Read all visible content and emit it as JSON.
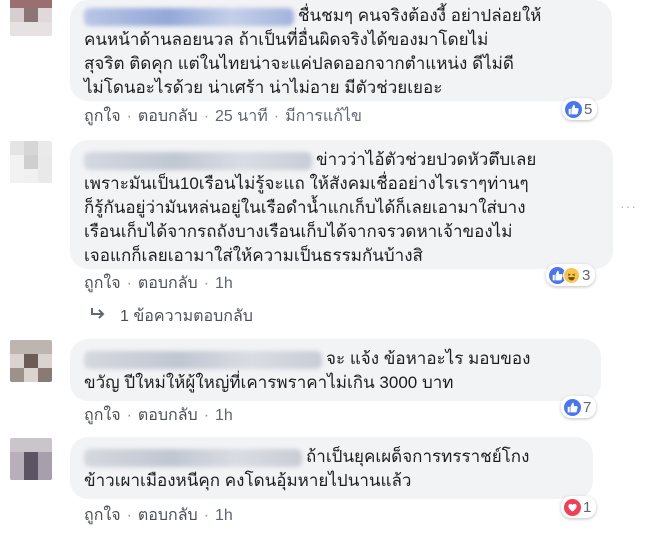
{
  "comments": [
    {
      "text": "ชื่นชมๆ คนจริงต้องงี้ อย่าปล่อยให้\nคนหน้าด้านลอยนวล ถ้าเป็นที่อื่นผิดจริงได้ของมาโดยไม่\nสุจริต ติดคุก แต่ในไทยน่าจะแค่ปลดออกจากตำแหน่ง ดีไม่ดี\nไม่โดนอะไรด้วย น่าเศร้า น่าไม่อาย มีตัวช่วยเยอะ",
      "actions": {
        "like": "ถูกใจ",
        "reply": "ตอบกลับ",
        "time": "25 นาที",
        "edited": "มีการแก้ไข"
      },
      "reaction_count": "5"
    },
    {
      "text": "ข่าวว่าไอ้ตัวช่วยปวดหัวตึบเลย\nเพราะมันเป็น10เรือนไม่รู้จะแถ ให้สังคมเชื่ออย่างไรเราๆท่านๆ\nก็รู้กันอยู่ว่ามันหล่นอยู่ในเรือดำน้ำแกเก็บได้ก็เลยเอามาใส่บาง\nเรือนเก็บได้จากรถถังบางเรือนเก็บได้จากจรวดหาเจ้าของไม่\nเจอแกก็เลยเอามาใส่ให้ความเป็นธรรมกันบ้างสิ",
      "actions": {
        "like": "ถูกใจ",
        "reply": "ตอบกลับ",
        "time": "1h"
      },
      "reaction_count": "3",
      "more": "···",
      "replies_label": "1 ข้อความตอบกลับ"
    },
    {
      "text": "จะ แจ้ง ข้อหาอะไร มอบของ\nขวัญ ปีใหม่ให้ผู้ใหญ่ที่เคารพราคาไม่เกิน 3000 บาท",
      "actions": {
        "like": "ถูกใจ",
        "reply": "ตอบกลับ",
        "time": "1h"
      },
      "reaction_count": "7"
    },
    {
      "text": "ถ้าเป็นยุคเผด็จการทรราชย์โกง\nข้าวเผาเมืองหนีคุก คงโดนอุ้มหายไปนานแล้ว",
      "actions": {
        "like": "ถูกใจ",
        "reply": "ตอบกลับ",
        "time": "1h"
      },
      "reaction_count": "1"
    }
  ],
  "colors": {
    "link": "#385898",
    "meta": "#606770",
    "bubble": "#f2f3f5",
    "like": "#4a75f0",
    "love": "#f33e58",
    "haha": "#f7c54c"
  },
  "icons": {
    "like": "thumbs-up-icon",
    "haha": "laughing-face-icon",
    "love": "heart-icon",
    "reply_arrow": "reply-arrow-icon"
  }
}
